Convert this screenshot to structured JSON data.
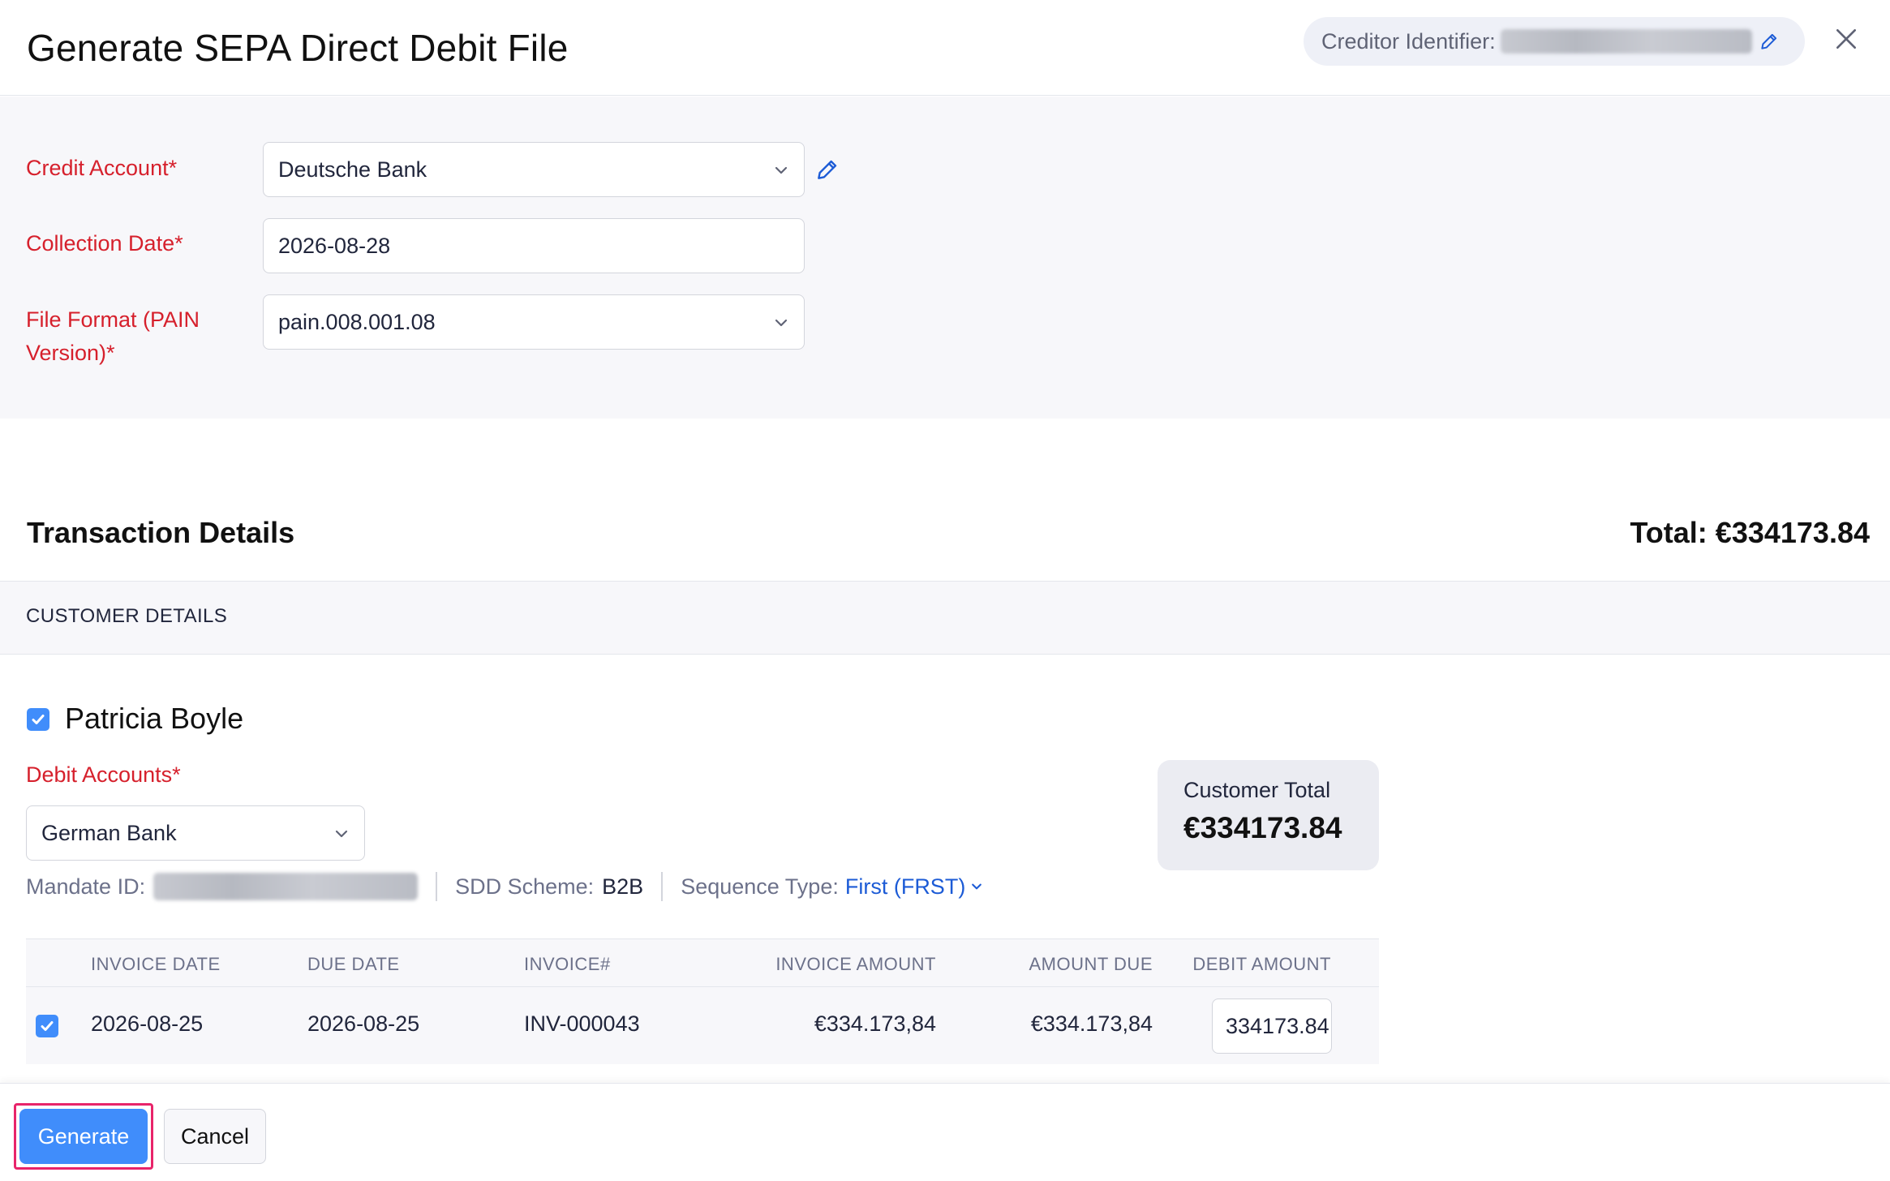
{
  "header": {
    "title": "Generate SEPA Direct Debit File",
    "creditor_identifier_label": "Creditor Identifier:"
  },
  "form": {
    "credit_account_label": "Credit Account*",
    "credit_account_value": "Deutsche Bank",
    "collection_date_label": "Collection Date*",
    "collection_date_value": "2026-08-28",
    "file_format_label_line1": "File Format (PAIN",
    "file_format_label_line2": "Version)*",
    "file_format_value": "pain.008.001.08"
  },
  "transactions": {
    "title": "Transaction Details",
    "total": "Total: €334173.84",
    "customer_details_label": "CUSTOMER DETAILS"
  },
  "customer": {
    "name": "Patricia Boyle",
    "selected": true,
    "debit_accounts_label": "Debit Accounts*",
    "debit_account_value": "German Bank",
    "mandate_id_label": "Mandate ID:",
    "sdd_scheme_label": "SDD Scheme:",
    "sdd_scheme_value": "B2B",
    "sequence_type_label": "Sequence Type:",
    "sequence_type_value": "First (FRST)",
    "total_label": "Customer Total",
    "total_value": "€334173.84"
  },
  "table": {
    "headers": [
      "INVOICE DATE",
      "DUE DATE",
      "INVOICE#",
      "INVOICE AMOUNT",
      "AMOUNT DUE",
      "DEBIT AMOUNT"
    ],
    "rows": [
      {
        "selected": true,
        "invoice_date": "2026-08-25",
        "due_date": "2026-08-25",
        "invoice_number": "INV-000043",
        "invoice_amount": "€334.173,84",
        "amount_due": "€334.173,84",
        "debit_amount": "334173.84"
      }
    ]
  },
  "footer": {
    "generate_label": "Generate",
    "cancel_label": "Cancel"
  },
  "colors": {
    "primary": "#408dfb",
    "required_label": "#d6202c",
    "link": "#1c5bd6",
    "focus_ring": "#e8246a"
  },
  "icons": [
    "pencil-icon",
    "close-icon",
    "chevron-down-icon",
    "checkmark-icon"
  ]
}
